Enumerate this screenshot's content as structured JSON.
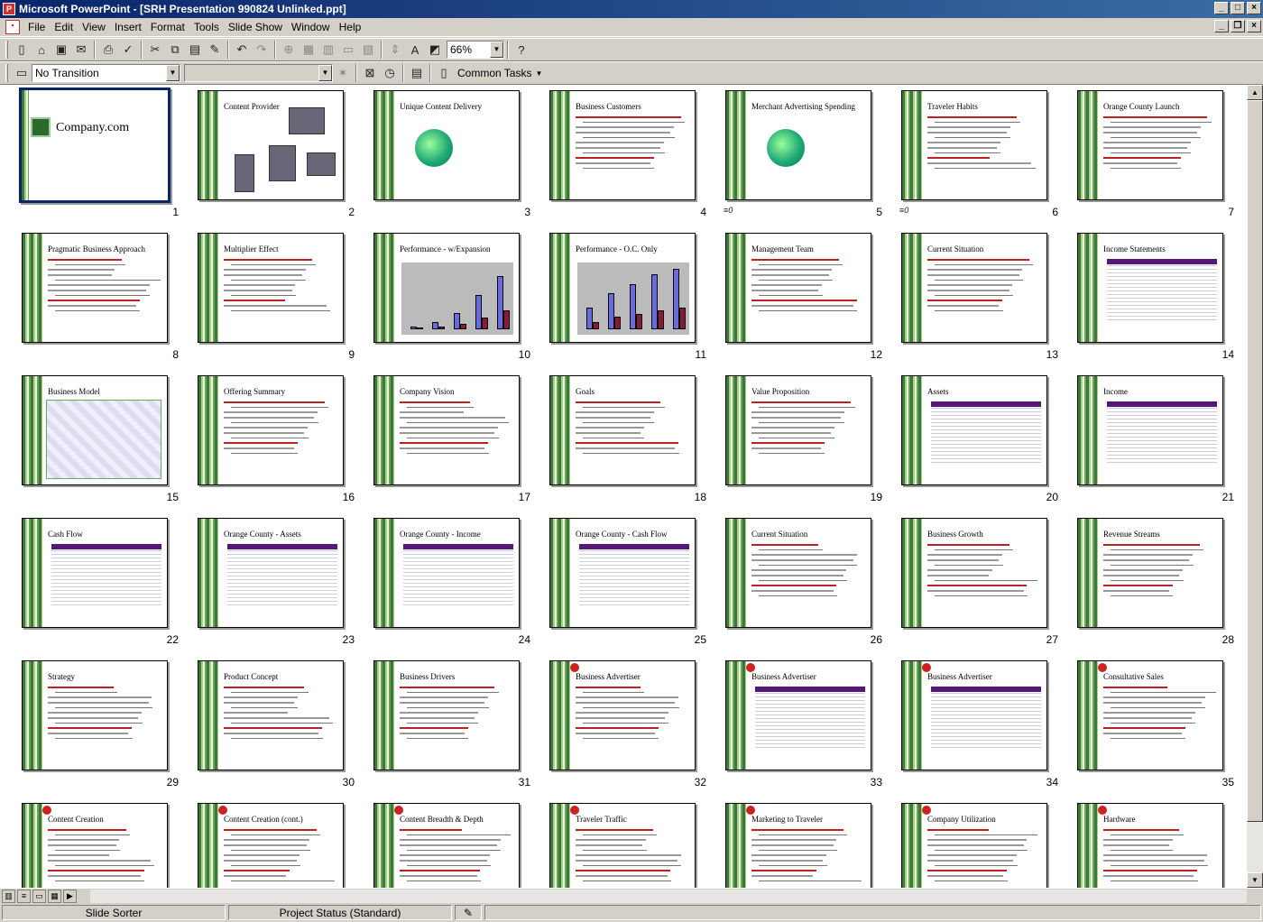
{
  "window": {
    "title": "Microsoft PowerPoint - [SRH Presentation 990824 Unlinked.ppt]"
  },
  "menu": [
    "File",
    "Edit",
    "View",
    "Insert",
    "Format",
    "Tools",
    "Slide Show",
    "Window",
    "Help"
  ],
  "toolbar": {
    "zoom": "66%",
    "transition": "No Transition",
    "common_tasks": "Common Tasks"
  },
  "slides": [
    {
      "n": "1",
      "title": "Company.com",
      "type": "cover"
    },
    {
      "n": "2",
      "title": "Content Provider",
      "type": "image"
    },
    {
      "n": "3",
      "title": "Unique Content Delivery",
      "type": "globe"
    },
    {
      "n": "4",
      "title": "Business Customers",
      "type": "bullets"
    },
    {
      "n": "5",
      "title": "Merchant Advertising Spending",
      "type": "globe",
      "transition": "≡0"
    },
    {
      "n": "6",
      "title": "Traveler Habits",
      "type": "bullets",
      "transition": "≡0"
    },
    {
      "n": "7",
      "title": "Orange County Launch",
      "type": "bullets"
    },
    {
      "n": "8",
      "title": "Pragmatic Business Approach",
      "type": "bullets"
    },
    {
      "n": "9",
      "title": "Multiplier Effect",
      "type": "bullets"
    },
    {
      "n": "10",
      "title": "Performance - w/Expansion",
      "type": "chart"
    },
    {
      "n": "11",
      "title": "Performance - O.C. Only",
      "type": "chart"
    },
    {
      "n": "12",
      "title": "Management Team",
      "type": "bullets"
    },
    {
      "n": "13",
      "title": "Current Situation",
      "type": "bullets"
    },
    {
      "n": "14",
      "title": "Income Statements",
      "type": "table"
    },
    {
      "n": "15",
      "title": "Business Model",
      "type": "diagram"
    },
    {
      "n": "16",
      "title": "Offering Summary",
      "type": "bullets"
    },
    {
      "n": "17",
      "title": "Company Vision",
      "type": "bullets"
    },
    {
      "n": "18",
      "title": "Goals",
      "type": "bullets"
    },
    {
      "n": "19",
      "title": "Value Proposition",
      "type": "bullets"
    },
    {
      "n": "20",
      "title": "Assets",
      "type": "table"
    },
    {
      "n": "21",
      "title": "Income",
      "type": "table"
    },
    {
      "n": "22",
      "title": "Cash Flow",
      "type": "table"
    },
    {
      "n": "23",
      "title": "Orange County - Assets",
      "type": "table"
    },
    {
      "n": "24",
      "title": "Orange County - Income",
      "type": "table"
    },
    {
      "n": "25",
      "title": "Orange County - Cash Flow",
      "type": "table"
    },
    {
      "n": "26",
      "title": "Current Situation",
      "type": "bullets"
    },
    {
      "n": "27",
      "title": "Business Growth",
      "type": "bullets"
    },
    {
      "n": "28",
      "title": "Revenue Streams",
      "type": "bullets"
    },
    {
      "n": "29",
      "title": "Strategy",
      "type": "bullets"
    },
    {
      "n": "30",
      "title": "Product Concept",
      "type": "bullets"
    },
    {
      "n": "31",
      "title": "Business Drivers",
      "type": "bullets"
    },
    {
      "n": "32",
      "title": "Business Advertiser",
      "type": "flagged"
    },
    {
      "n": "33",
      "title": "Business Advertiser",
      "type": "flaggedtable"
    },
    {
      "n": "34",
      "title": "Business Advertiser",
      "type": "flaggedtable"
    },
    {
      "n": "35",
      "title": "Consultative Sales",
      "type": "flagged"
    },
    {
      "n": "",
      "title": "Content Creation",
      "type": "flagged"
    },
    {
      "n": "",
      "title": "Content Creation (cont.)",
      "type": "flagged"
    },
    {
      "n": "",
      "title": "Content Breadth & Depth",
      "type": "flagged"
    },
    {
      "n": "",
      "title": "Traveler Traffic",
      "type": "flagged"
    },
    {
      "n": "",
      "title": "Marketing to Traveler",
      "type": "flagged"
    },
    {
      "n": "",
      "title": "Company Utilization",
      "type": "flagged"
    },
    {
      "n": "",
      "title": "Hardware",
      "type": "flagged"
    }
  ],
  "status": {
    "view": "Slide Sorter",
    "design": "Project Status (Standard)"
  }
}
